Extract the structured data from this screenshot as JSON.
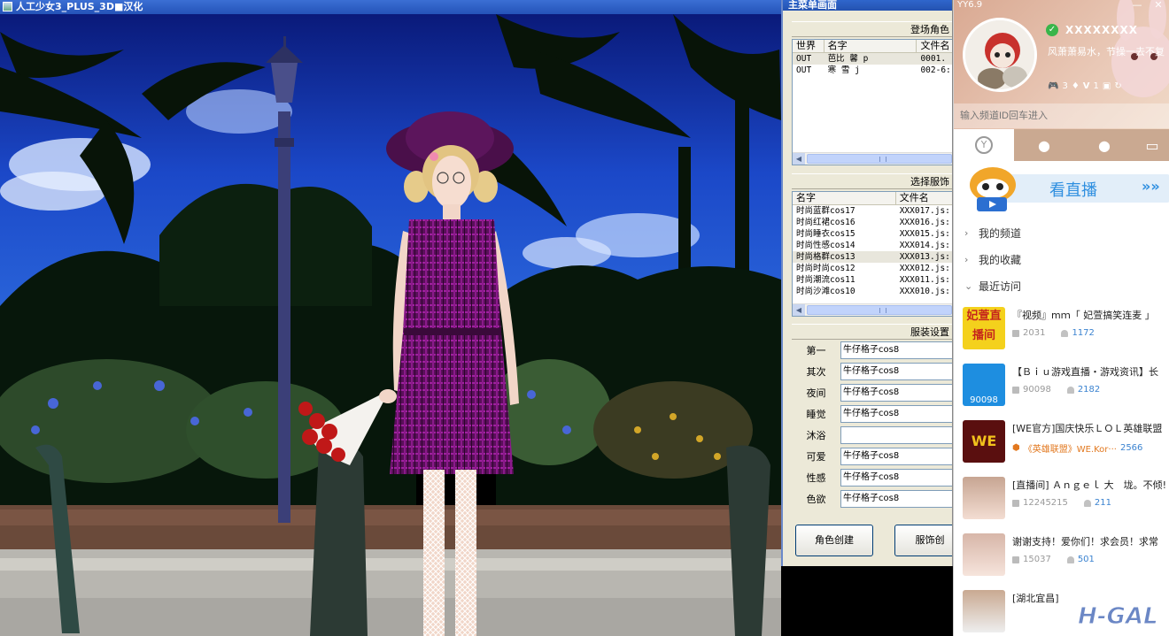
{
  "game": {
    "title": "人工少女3_PLUS_3D■汉化"
  },
  "menu": {
    "title": "主菜单画面",
    "character_group": "登场角色",
    "char_columns": [
      "世界",
      "名字",
      "文件名"
    ],
    "characters": [
      {
        "world": "OUT",
        "name": "芭比 馨 p",
        "file": "0001."
      },
      {
        "world": "OUT",
        "name": "寒 雪 j",
        "file": "002-6:"
      }
    ],
    "outfit_group": "选择服饰",
    "outfit_columns": [
      "名字",
      "文件名"
    ],
    "outfits": [
      {
        "name": "时尚蓝群cos17",
        "file": "XXX017.js:"
      },
      {
        "name": "时尚红裙cos16",
        "file": "XXX016.js:"
      },
      {
        "name": "时尚睡衣cos15",
        "file": "XXX015.js:"
      },
      {
        "name": "时尚性感cos14",
        "file": "XXX014.js:"
      },
      {
        "name": "时尚格群cos13",
        "file": "XXX013.js:"
      },
      {
        "name": "时尚时尚cos12",
        "file": "XXX012.js:"
      },
      {
        "name": "时尚潮流cos11",
        "file": "XXX011.js:"
      },
      {
        "name": "时尚沙滩cos10",
        "file": "XXX010.js:"
      }
    ],
    "outfit_settings_title": "服装设置",
    "outfit_settings": [
      {
        "label": "第一",
        "value": "牛仔格子cos8"
      },
      {
        "label": "其次",
        "value": "牛仔格子cos8"
      },
      {
        "label": "夜间",
        "value": "牛仔格子cos8"
      },
      {
        "label": "睡觉",
        "value": "牛仔格子cos8"
      },
      {
        "label": "沐浴",
        "value": ""
      },
      {
        "label": "可爱",
        "value": "牛仔格子cos8"
      },
      {
        "label": "性感",
        "value": "牛仔格子cos8"
      },
      {
        "label": "色欲",
        "value": "牛仔格子cos8"
      }
    ],
    "create_char_button": "角色创建",
    "create_outfit_button": "服饰创"
  },
  "yy": {
    "version": "YY6.9",
    "username": "XXXXXXXX",
    "signature": "风萧萧易水，节操一去不复",
    "badges": [
      "3",
      "1"
    ],
    "channel_input_placeholder": "输入频道ID回车进入",
    "live_banner": "看直播",
    "live_arrows": "»»",
    "nav": [
      {
        "label": "我的频道",
        "chev": "›"
      },
      {
        "label": "我的收藏",
        "chev": "›"
      },
      {
        "label": "最近访问",
        "chev": "⌄"
      }
    ],
    "channels": [
      {
        "name": "『视频』mｍ「 妃萱搞笑连麦 」",
        "id": "2031",
        "count": "1172",
        "logo_text": "妃萱直播间"
      },
      {
        "name": "【Ｂｉｕ游戏直播・游戏资讯】长",
        "id": "90098",
        "count": "2182",
        "logo_text": "90098"
      },
      {
        "name": "[WE官方]国庆快乐ＬＯＬ英雄联盟",
        "id": "",
        "tag": "《英雄联盟》WE.Kor···",
        "count": "2566",
        "logo_text": "WE"
      },
      {
        "name": "[直播间] Ａｎｇｅｌ 大　垅。不倾!",
        "id": "12245215",
        "count": "211",
        "logo_text": ""
      },
      {
        "name": "谢谢支持！爱你们！求会员！求常",
        "id": "15037",
        "count": "501",
        "logo_text": ""
      },
      {
        "name": "[湖北宜昌]",
        "id": "",
        "count": "",
        "logo_text": ""
      }
    ]
  },
  "watermark": "H-GAL"
}
